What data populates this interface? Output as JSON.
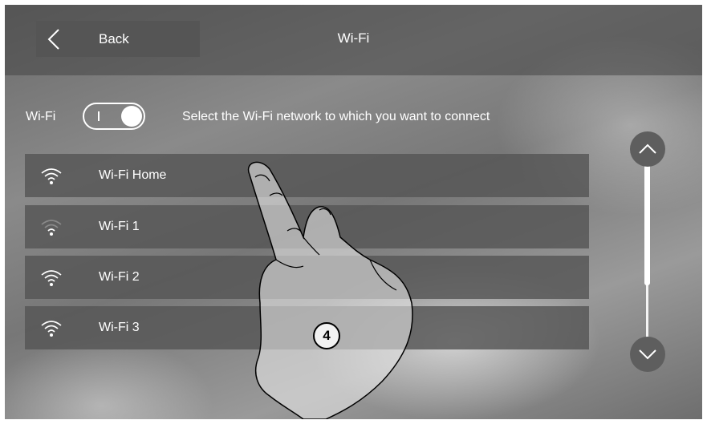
{
  "header": {
    "back_label": "Back",
    "title": "Wi-Fi"
  },
  "wifi_toggle": {
    "label": "Wi-Fi",
    "state": "on"
  },
  "hint": "Select the Wi-Fi network to which you want to connect",
  "networks": [
    {
      "name": "Wi-Fi Home",
      "signal": "strong"
    },
    {
      "name": "Wi-Fi 1",
      "signal": "weak"
    },
    {
      "name": "Wi-Fi 2",
      "signal": "strong"
    },
    {
      "name": "Wi-Fi 3",
      "signal": "strong"
    }
  ],
  "callout": "4",
  "icons": [
    "chevron-left-icon",
    "wifi-icon",
    "chevron-up-icon",
    "chevron-down-icon",
    "pointing-hand-icon"
  ]
}
